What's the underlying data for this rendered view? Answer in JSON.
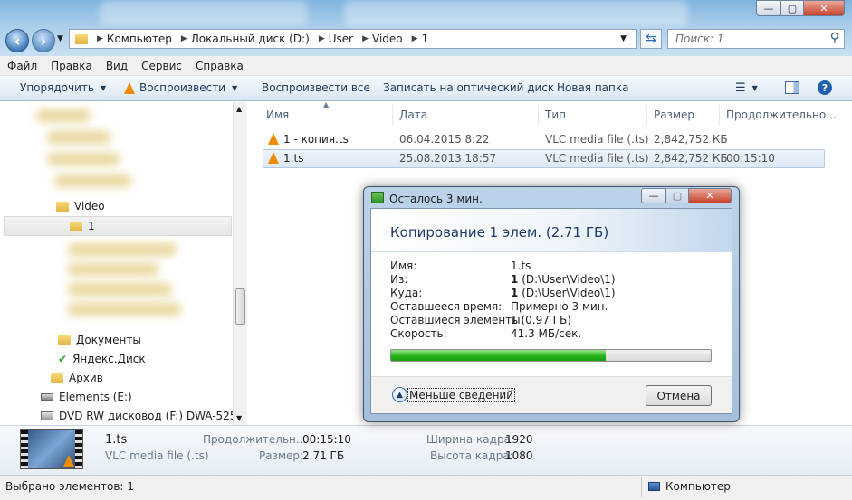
{
  "window": {
    "address_parts": [
      "Компьютер",
      "Локальный диск (D:)",
      "User",
      "Video",
      "1"
    ],
    "search_placeholder": "Поиск: 1",
    "min_glyph": "—",
    "max_glyph": "▢",
    "close_glyph": "✕"
  },
  "menu": [
    "Файл",
    "Правка",
    "Вид",
    "Сервис",
    "Справка"
  ],
  "toolbar": {
    "organize": "Упорядочить",
    "play": "Воспроизвести",
    "play_all": "Воспроизвести все",
    "burn": "Записать на оптический диск",
    "new_folder": "Новая папка"
  },
  "nav": {
    "items": [
      {
        "label": "Video"
      },
      {
        "label": "1"
      },
      {
        "label": "Документы"
      },
      {
        "label": "Яндекс.Диск"
      },
      {
        "label": "Архив"
      },
      {
        "label": "Elements (E:)"
      },
      {
        "label": "DVD RW дисковод (F:) DWA-525"
      }
    ]
  },
  "columns": [
    "Имя",
    "Дата",
    "Тип",
    "Размер",
    "Продолжительно..."
  ],
  "files": [
    {
      "name": "1 - копия.ts",
      "date": "06.04.2015 8:22",
      "type": "VLC media file (.ts)",
      "size": "2,842,752 КБ",
      "duration": ""
    },
    {
      "name": "1.ts",
      "date": "25.08.2013 18:57",
      "type": "VLC media file (.ts)",
      "size": "2,842,752 КБ",
      "duration": "00:15:10"
    }
  ],
  "details": {
    "name": "1.ts",
    "type": "VLC media file (.ts)",
    "duration_label": "Продолжительн...",
    "duration_value": "00:15:10",
    "size_label": "Размер:",
    "size_value": "2.71 ГБ",
    "width_label": "Ширина кадра:",
    "width_value": "1920",
    "height_label": "Высота кадра:",
    "height_value": "1080"
  },
  "status": {
    "selected": "Выбрано элементов: 1",
    "location": "Компьютер"
  },
  "dialog": {
    "title": "Осталось 3 мин.",
    "heading": "Копирование 1 элем. (2.71 ГБ)",
    "labels": [
      "Имя:",
      "Из:",
      "Куда:",
      "Оставшееся время:",
      "Оставшиеся элементы:",
      "Скорость:"
    ],
    "name": "1.ts",
    "from_bold": "1",
    "from_path": "(D:\\User\\Video\\1)",
    "to_bold": "1",
    "to_path": "(D:\\User\\Video\\1)",
    "time_left": "Примерно 3 мин.",
    "items_left": "1 (0.97 ГБ)",
    "speed": "41.3 МБ/сек.",
    "progress": 0.67,
    "less_details": "Меньше сведений",
    "cancel": "Отмена"
  },
  "colors": {
    "accent": "#1e3a6a",
    "progress": "#27b41b"
  }
}
